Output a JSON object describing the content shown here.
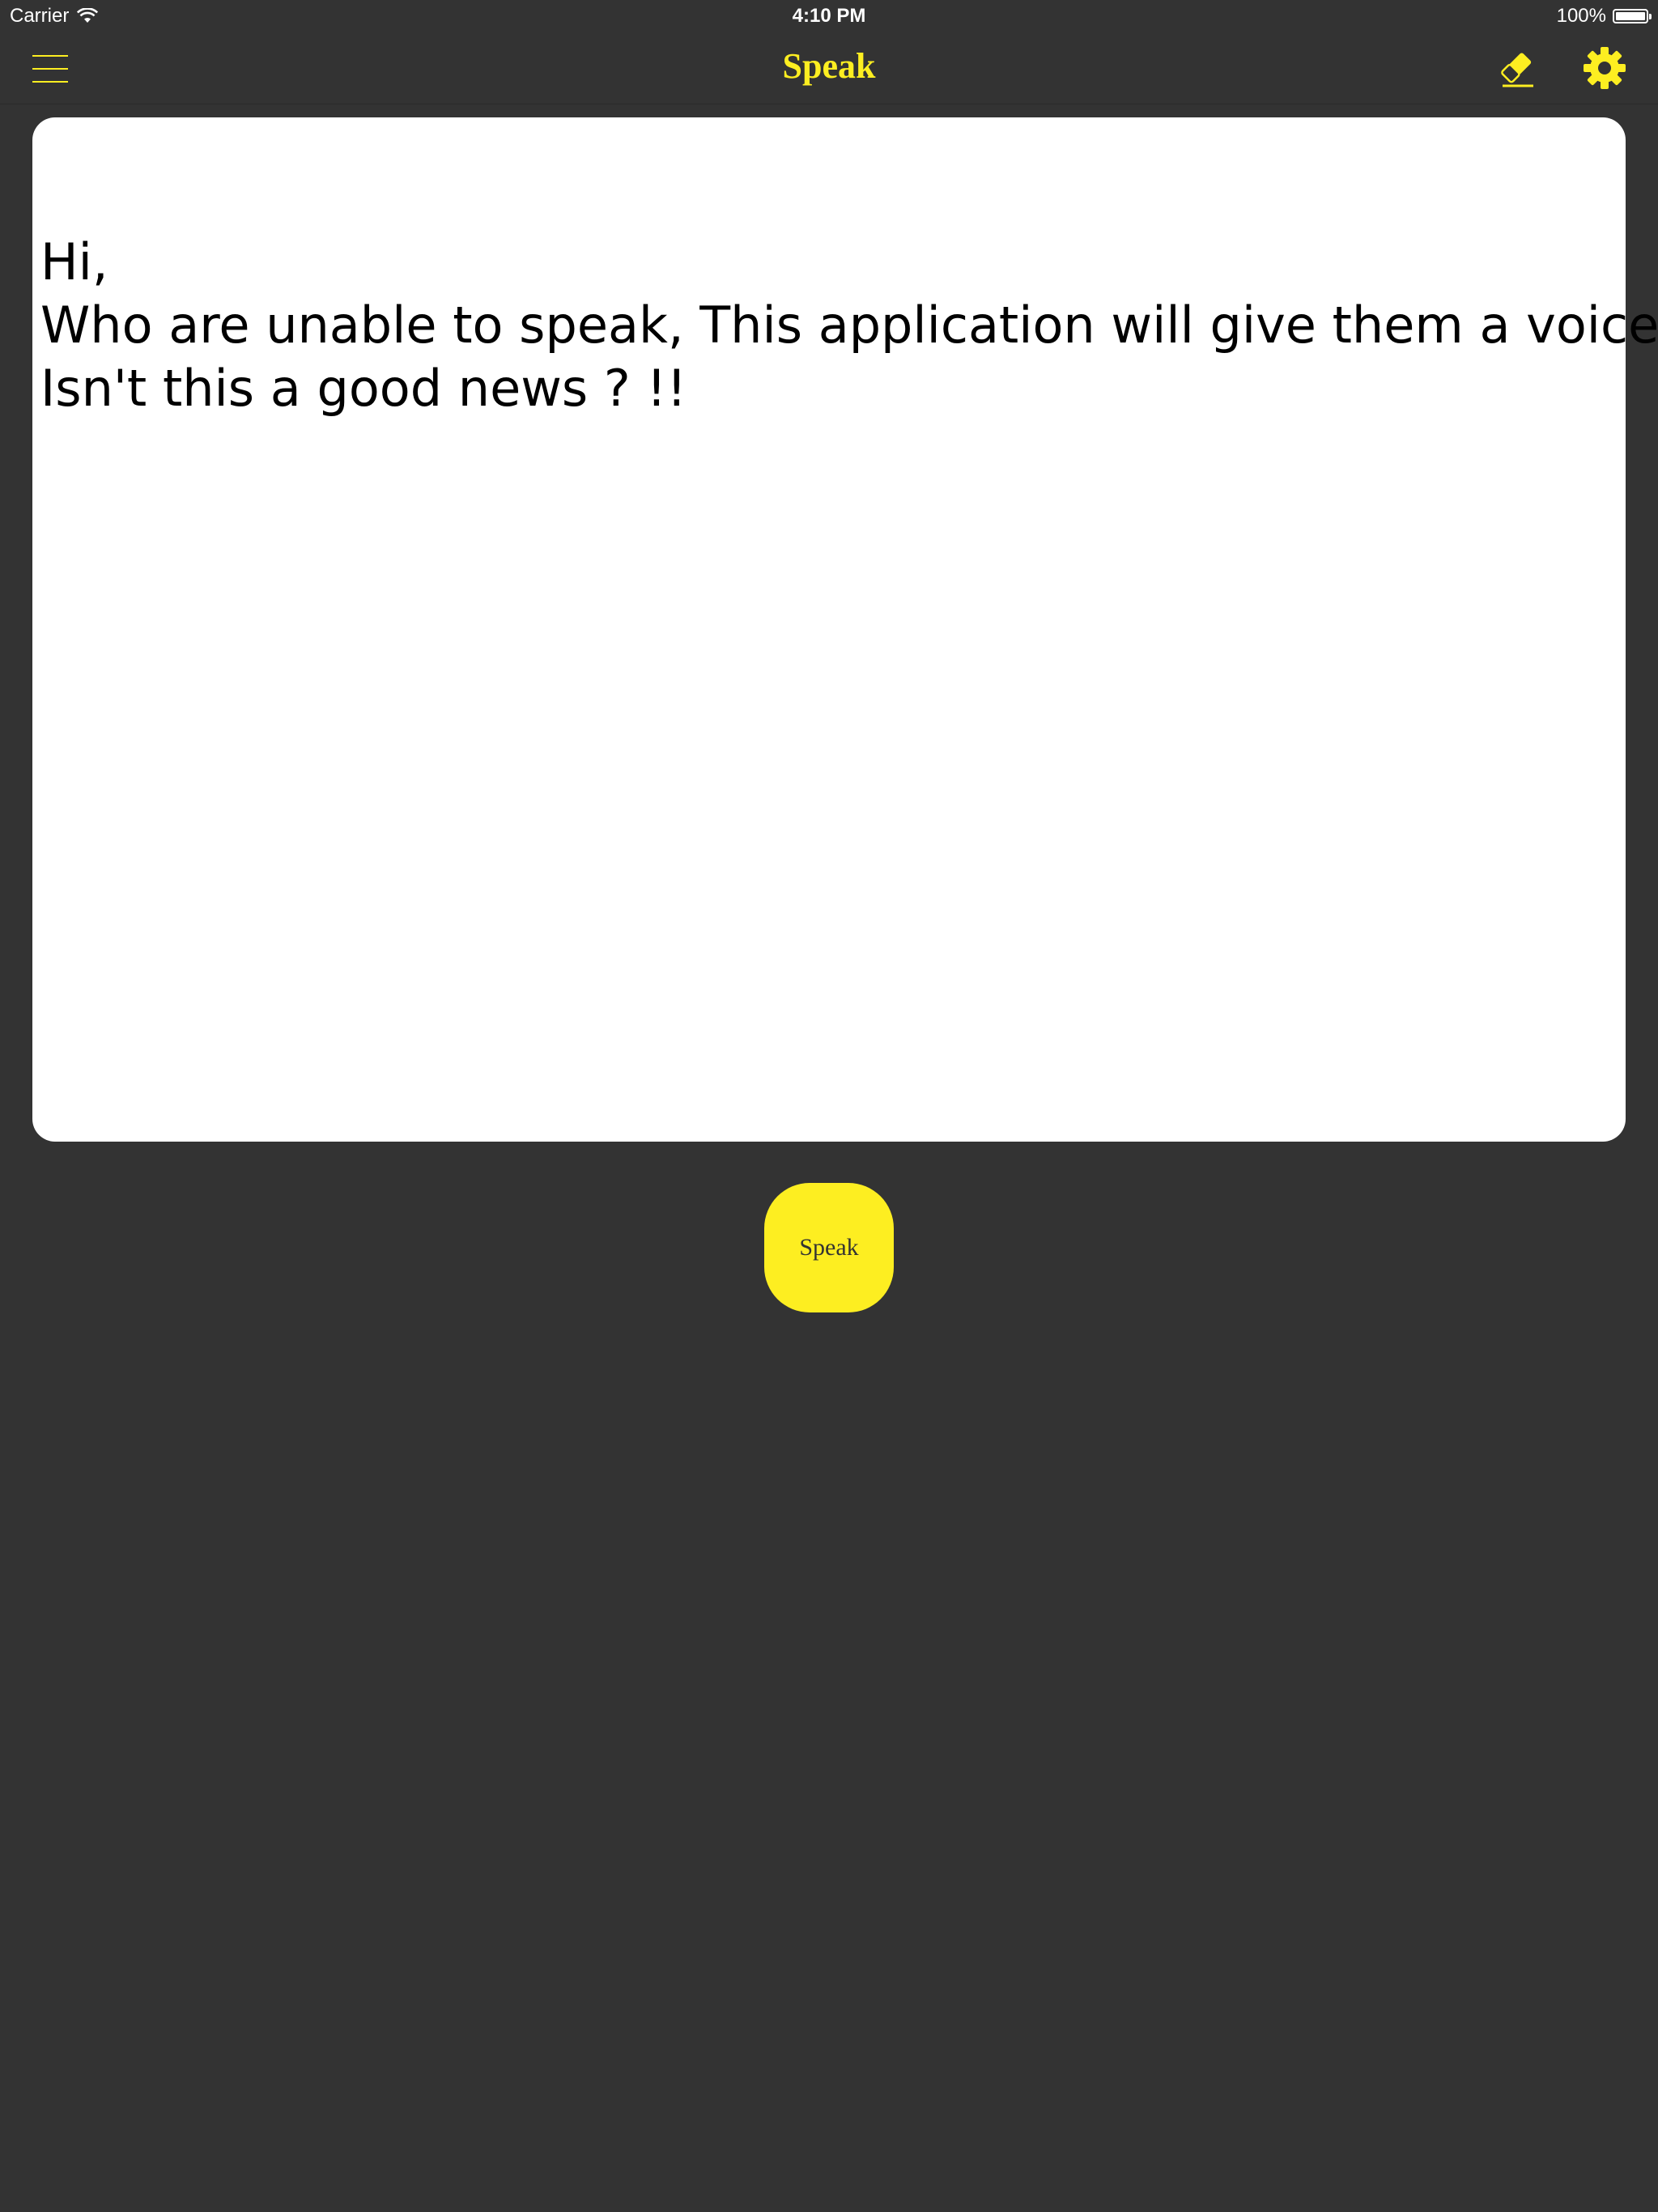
{
  "status_bar": {
    "carrier": "Carrier",
    "time": "4:10 PM",
    "battery_text": "100%",
    "battery_level": 1.0
  },
  "nav_bar": {
    "title": "Speak",
    "left_icon": "menu-icon",
    "right_icons": [
      "eraser-icon",
      "gear-icon"
    ],
    "accent_color": "#fdee21"
  },
  "text_area": {
    "lines": [
      "Hi,",
      "Who are unable to speak, This application will give them a voice.",
      "Isn't this a good news ? !!"
    ]
  },
  "speak_button": {
    "label": "Speak"
  },
  "colors": {
    "background": "#333333",
    "accent": "#fdee21",
    "card": "#ffffff"
  }
}
